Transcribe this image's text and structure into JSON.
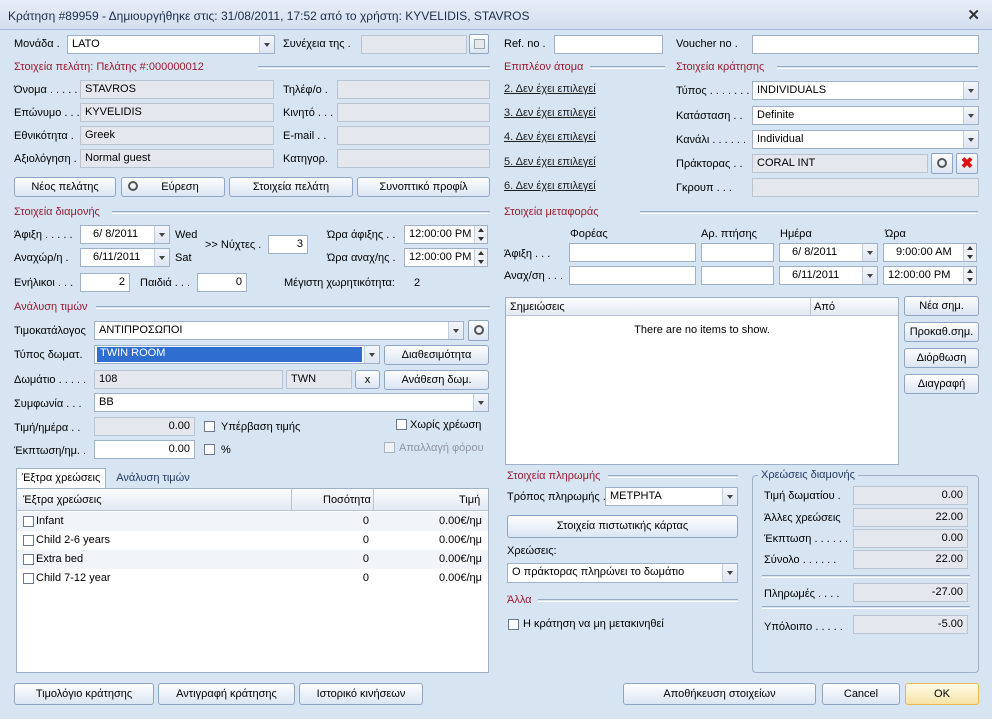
{
  "window": {
    "title": "Κράτηση #89959 - Δημιουργήθηκε στις: 31/08/2011, 17:52 από το χρήστη: KYVELIDIS, STAVROS"
  },
  "top": {
    "monada_label": "Μονάδα .",
    "monada_value": "LATO",
    "synexeia_label": "Συνέχεια της .",
    "ref_label": "Ref. no .",
    "voucher_label": "Voucher no ."
  },
  "client": {
    "section": "Στοιχεία πελάτη: Πελάτης #:000000012",
    "first_label": "Όνομα . . . . .",
    "first": "STAVROS",
    "last_label": "Επώνυμο . . .",
    "last": "KYVELIDIS",
    "nat_label": "Εθνικότητα .",
    "nat": "Greek",
    "rating_label": "Αξιολόγηση .",
    "rating": "Normal guest",
    "phone_label": "Τηλέφ/ο .",
    "mobile_label": "Κινητό . . .",
    "email_label": "E-mail . .",
    "category_label": "Κατηγορ.",
    "new_btn": "Νέος πελάτης",
    "find_btn": "Εύρεση",
    "details_btn": "Στοιχεία πελάτη",
    "profile_btn": "Συνοπτικό προφίλ"
  },
  "extra": {
    "section": "Επιπλέον άτομα",
    "items": [
      "2. Δεν έχει επιλεγεί",
      "3. Δεν έχει επιλεγεί",
      "4. Δεν έχει επιλεγεί",
      "5. Δεν έχει επιλεγεί",
      "6. Δεν έχει επιλεγεί"
    ]
  },
  "booking": {
    "section": "Στοιχεία κράτησης",
    "type_label": "Τύπος . . . . . . . .",
    "type": "INDIVIDUALS",
    "status_label": "Κατάσταση . .",
    "status": "Definite",
    "channel_label": "Κανάλι . . . . . .",
    "channel": "Individual",
    "agent_label": "Πράκτορας . .",
    "agent": "CORAL INT",
    "group_label": "Γκρουπ . . ."
  },
  "stay": {
    "section": "Στοιχεία διαμονής",
    "arr_label": "Άφιξη . . . . .",
    "arr": "6/ 8/2011",
    "arr_day": "Wed",
    "dep_label": "Αναχώρ/η .",
    "dep": "6/11/2011",
    "dep_day": "Sat",
    "nights_label": ">> Νύχτες .",
    "nights": "3",
    "arr_time_label": "Ώρα άφιξης . .",
    "arr_time": "12:00:00 PM",
    "dep_time_label": "Ώρα αναχ/ης .",
    "dep_time": "12:00:00 PM",
    "adults_label": "Ενήλικοι . . .",
    "adults": "2",
    "children_label": "Παιδιά . . .",
    "children": "0",
    "cap_label": "Μέγιστη χωρητικότητα:",
    "cap": "2"
  },
  "transport": {
    "section": "Στοιχεία μεταφοράς",
    "carrier_col": "Φορέας",
    "flight_col": "Αρ. πτήσης",
    "date_col": "Ημέρα",
    "time_col": "Ώρα",
    "arr_label": "Άφιξη . . .",
    "dep_label": "Αναχ/ση . . .",
    "arr_date": "6/ 8/2011",
    "arr_time": "9:00:00 AM",
    "dep_date": "6/11/2011",
    "dep_time": "12:00:00 PM"
  },
  "rates": {
    "section": "Ανάλυση τιμών",
    "pricelist_label": "Τιμοκατάλογος",
    "pricelist": "ΑΝΤΙΠΡΟΣΩΠΟΙ",
    "roomtype_label": "Τύπος δωματ.",
    "roomtype": "TWIN ROOM",
    "avail_btn": "Διαθεσιμότητα",
    "room_label": "Δωμάτιο . . . . .",
    "room": "108",
    "room_code": "TWN",
    "x_btn": "x",
    "assign_btn": "Ανάθεση δωμ.",
    "board_label": "Συμφωνία . . .",
    "board": "BB",
    "price_label": "Τιμή/ημέρα . .",
    "price": "0.00",
    "override_label": "Υπέρβαση τιμής",
    "nocharge_label": "Χωρίς χρέωση",
    "discount_label": "Έκπτωση/ημ. .",
    "discount": "0.00",
    "pct_label": "%",
    "taxfree_label": "Απαλλαγή φόρου"
  },
  "tabs": [
    "Έξτρα χρεώσεις",
    "Ανάλυση τιμών"
  ],
  "extras": {
    "columns": [
      "Έξτρα χρεώσεις",
      "Ποσότητα",
      "Τιμή"
    ],
    "rows": [
      {
        "name": "Infant",
        "qty": "0",
        "price": "0.00€/ημ"
      },
      {
        "name": "Child 2-6 years",
        "qty": "0",
        "price": "0.00€/ημ"
      },
      {
        "name": "Extra bed",
        "qty": "0",
        "price": "0.00€/ημ"
      },
      {
        "name": "Child 7-12 year",
        "qty": "0",
        "price": "0.00€/ημ"
      }
    ]
  },
  "notes": {
    "col_notes": "Σημειώσεις",
    "col_from": "Από",
    "empty": "There are no items to show.",
    "new_btn": "Νέα σημ.",
    "preset_btn": "Προκαθ.σημ.",
    "edit_btn": "Διόρθωση",
    "delete_btn": "Διαγραφή"
  },
  "payment": {
    "section": "Στοιχεία πληρωμής",
    "method_label": "Τρόπος πληρωμής .",
    "method": "ΜΕΤΡΗΤΑ",
    "card_btn": "Στοιχεία πιστωτικής κάρτας",
    "charges_label": "Χρεώσεις:",
    "charges": "Ο πράκτορας πληρώνει το δωμάτιο"
  },
  "other": {
    "section": "Άλλα",
    "lock_label": "Η κράτηση να μη μετακινηθεί"
  },
  "totals": {
    "section": "Χρεώσεις διαμονής",
    "room_label": "Τιμή δωματίου .",
    "room": "0.00",
    "other_label": "Άλλες χρεώσεις",
    "other": "22.00",
    "disc_label": "Έκπτωση . . . . . .",
    "disc": "0.00",
    "sum_label": "Σύνολο . . . . . .",
    "sum": "22.00",
    "pay_label": "Πληρωμές . . . .",
    "pay": "-27.00",
    "bal_label": "Υπόλοιπο . . . . .",
    "bal": "-5.00"
  },
  "footer": {
    "invoice_btn": "Τιμολόγιο κράτησης",
    "copy_btn": "Αντιγραφή κράτησης",
    "history_btn": "Ιστορικό κινήσεων",
    "save_btn": "Αποθήκευση στοιχείων",
    "cancel_btn": "Cancel",
    "ok_btn": "OK"
  }
}
